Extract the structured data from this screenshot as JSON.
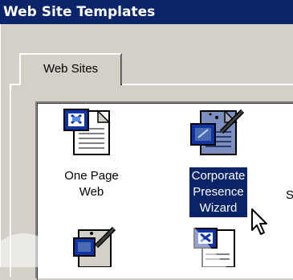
{
  "window": {
    "title": "Web Site Templates"
  },
  "tabs": [
    {
      "label": "Web Sites",
      "selected": true
    }
  ],
  "templates": [
    {
      "label": "One Page\nWeb",
      "icon": "one-page-web-icon",
      "selected": false
    },
    {
      "label": "Corporate\nPresence\nWizard",
      "icon": "wizard-icon",
      "selected": true
    },
    {
      "label": "S",
      "icon": "",
      "selected": false
    },
    {
      "label": "",
      "icon": "wizard-icon",
      "selected": false
    },
    {
      "label": "",
      "icon": "one-page-web-icon",
      "selected": false
    }
  ],
  "colors": {
    "title_bar": "#0a246a",
    "selection": "#0a246a",
    "dialog_face": "#d4d0c8",
    "list_background": "#ffffff"
  }
}
